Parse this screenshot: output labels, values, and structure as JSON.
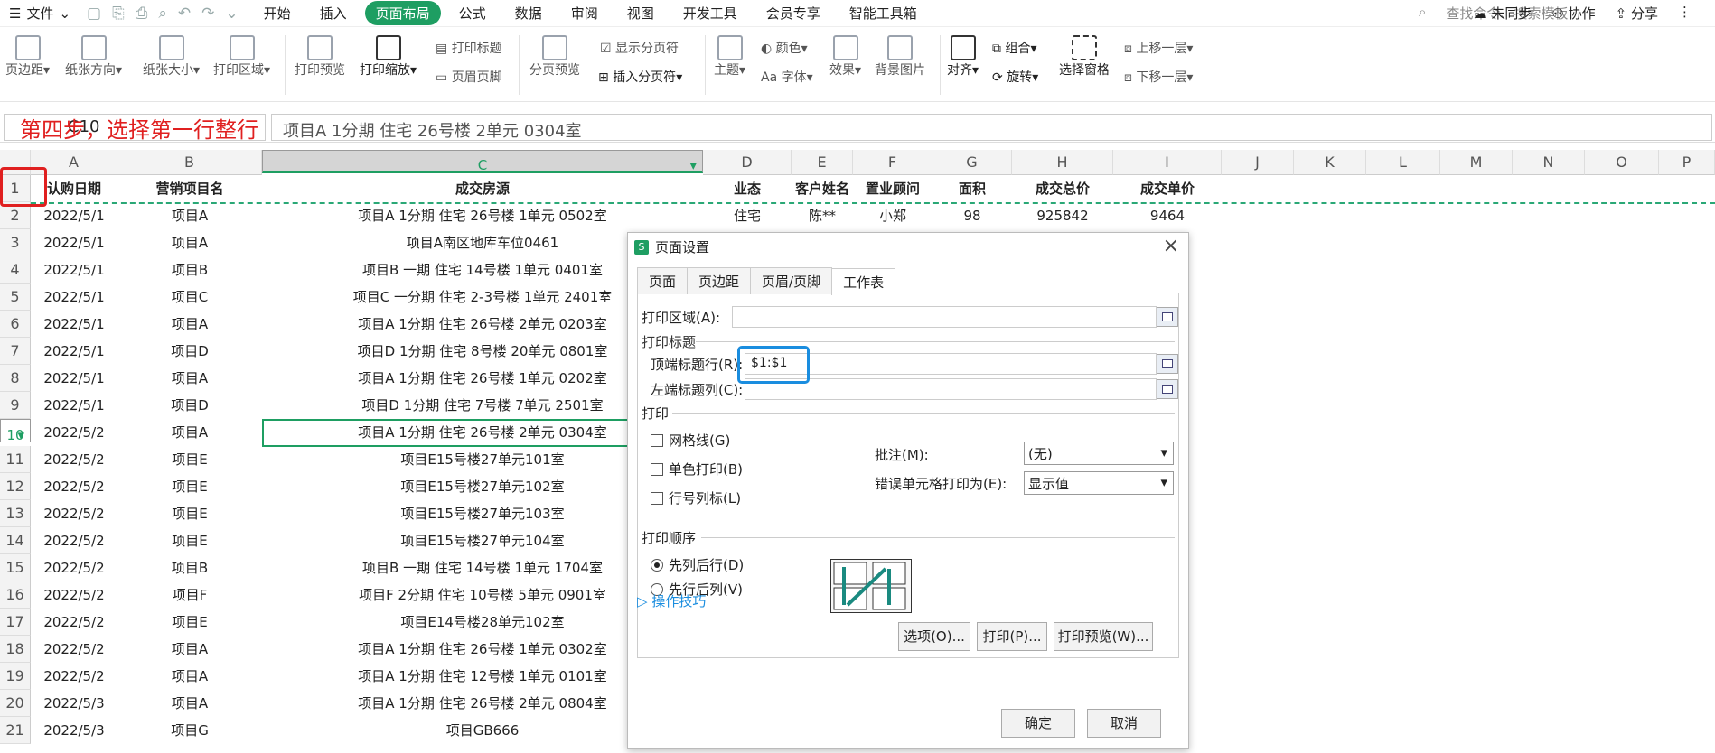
{
  "menubar": {
    "file": "文件",
    "tabs": [
      "开始",
      "插入",
      "页面布局",
      "公式",
      "数据",
      "审阅",
      "视图",
      "开发工具",
      "会员专享",
      "智能工具箱"
    ],
    "search": "查找命令、搜索模板",
    "unsync": "未同步",
    "collab": "协作",
    "share": "分享"
  },
  "ribbon": {
    "margins": "页边距",
    "orientation": "纸张方向",
    "size": "纸张大小",
    "print_area": "打印区域",
    "print_preview": "打印预览",
    "print_scale": "打印缩放",
    "print_titles": "打印标题",
    "header_footer": "页眉页脚",
    "pagebreak_preview": "分页预览",
    "show_breaks": "显示分页符",
    "insert_break": "插入分页符",
    "theme": "主题",
    "color": "颜色",
    "font": "字体",
    "effect": "效果",
    "background": "背景图片",
    "align": "对齐",
    "group": "组合",
    "rotate": "旋转",
    "select_pane": "选择窗格",
    "bring_forward": "上移一层",
    "send_backward": "下移一层"
  },
  "formula": {
    "namebox": "C10",
    "content": "项目A 1分期 住宅 26号楼 2单元 0304室"
  },
  "annotation": "第四步，选择第一行整行",
  "columns": [
    "A",
    "B",
    "C",
    "D",
    "E",
    "F",
    "G",
    "H",
    "I",
    "J",
    "K",
    "L",
    "M",
    "N",
    "O",
    "P"
  ],
  "headers": [
    "认购日期",
    "营销项目名",
    "成交房源",
    "业态",
    "客户姓名",
    "置业顾问",
    "面积",
    "成交总价",
    "成交单价"
  ],
  "row2": [
    "住宅",
    "陈**",
    "小郑",
    "98",
    "925842",
    "9464"
  ],
  "rows": [
    [
      "2",
      "2022/5/1",
      "项目A",
      "项目A 1分期 住宅 26号楼 1单元 0502室"
    ],
    [
      "3",
      "2022/5/1",
      "项目A",
      "项目A南区地库车位0461"
    ],
    [
      "4",
      "2022/5/1",
      "项目B",
      "项目B 一期 住宅 14号楼 1单元 0401室"
    ],
    [
      "5",
      "2022/5/1",
      "项目C",
      "项目C 一分期 住宅 2-3号楼 1单元 2401室"
    ],
    [
      "6",
      "2022/5/1",
      "项目A",
      "项目A 1分期 住宅 26号楼 2单元 0203室"
    ],
    [
      "7",
      "2022/5/1",
      "项目D",
      "项目D 1分期 住宅 8号楼 20单元 0801室"
    ],
    [
      "8",
      "2022/5/1",
      "项目A",
      "项目A 1分期 住宅 26号楼 1单元 0202室"
    ],
    [
      "9",
      "2022/5/1",
      "项目D",
      "项目D 1分期 住宅 7号楼 7单元 2501室"
    ],
    [
      "10",
      "2022/5/2",
      "项目A",
      "项目A 1分期 住宅 26号楼 2单元 0304室"
    ],
    [
      "11",
      "2022/5/2",
      "项目E",
      "项目E15号楼27单元101室"
    ],
    [
      "12",
      "2022/5/2",
      "项目E",
      "项目E15号楼27单元102室"
    ],
    [
      "13",
      "2022/5/2",
      "项目E",
      "项目E15号楼27单元103室"
    ],
    [
      "14",
      "2022/5/2",
      "项目E",
      "项目E15号楼27单元104室"
    ],
    [
      "15",
      "2022/5/2",
      "项目B",
      "项目B 一期 住宅 14号楼 1单元 1704室"
    ],
    [
      "16",
      "2022/5/2",
      "项目F",
      "项目F 2分期 住宅 10号楼 5单元 0901室"
    ],
    [
      "17",
      "2022/5/2",
      "项目E",
      "项目E14号楼28单元102室"
    ],
    [
      "18",
      "2022/5/2",
      "项目A",
      "项目A 1分期 住宅 26号楼 1单元 0302室"
    ],
    [
      "19",
      "2022/5/2",
      "项目A",
      "项目A 1分期 住宅 12号楼 1单元 0101室"
    ],
    [
      "20",
      "2022/5/3",
      "项目A",
      "项目A 1分期 住宅 26号楼 2单元 0804室"
    ],
    [
      "21",
      "2022/5/3",
      "项目G",
      "项目GB666"
    ]
  ],
  "dialog": {
    "title": "页面设置",
    "tabs": [
      "页面",
      "页边距",
      "页眉/页脚",
      "工作表"
    ],
    "print_area": "打印区域(A):",
    "print_titles": "打印标题",
    "top_rows": "顶端标题行(R):",
    "top_rows_value": "$1:$1",
    "left_cols": "左端标题列(C):",
    "print": "打印",
    "gridlines": "网格线(G)",
    "mono": "单色打印(B)",
    "rowcol": "行号列标(L)",
    "comments": "批注(M):",
    "comments_value": "(无)",
    "errors": "错误单元格打印为(E):",
    "errors_value": "显示值",
    "order": "打印顺序",
    "down_over": "先列后行(D)",
    "over_down": "先行后列(V)",
    "options": "选项(O)...",
    "print_btn": "打印(P)...",
    "preview": "打印预览(W)...",
    "tips": "操作技巧",
    "ok": "确定",
    "cancel": "取消"
  }
}
